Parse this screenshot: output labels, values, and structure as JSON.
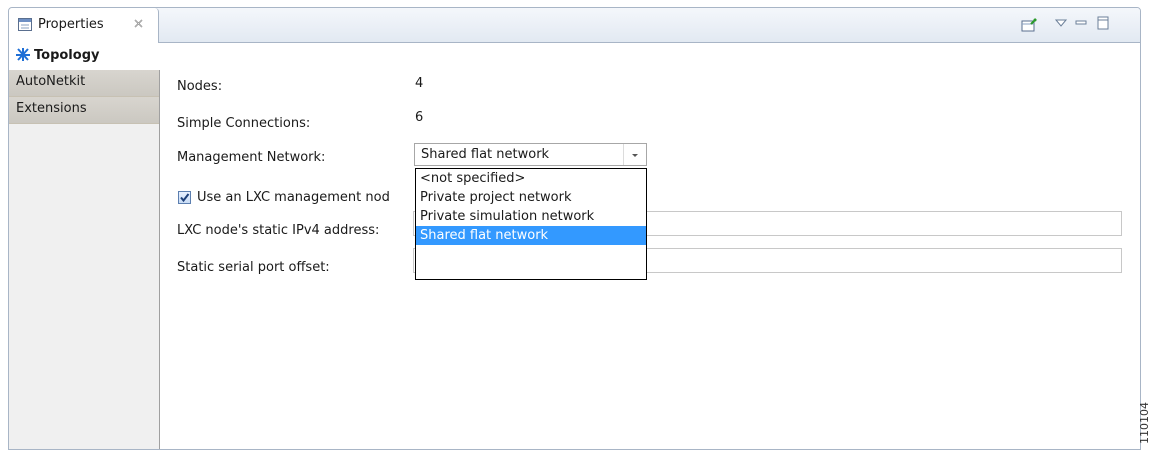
{
  "tab": {
    "title": "Properties"
  },
  "sidebar": {
    "items": [
      {
        "label": "Topology"
      },
      {
        "label": "AutoNetkit"
      },
      {
        "label": "Extensions"
      }
    ]
  },
  "form": {
    "nodes_label": "Nodes:",
    "nodes_value": "4",
    "connections_label": "Simple Connections:",
    "connections_value": "6",
    "mgmt_label": "Management Network:",
    "mgmt_selected": "Shared flat network",
    "lxc_checkbox_label": "Use an LXC management nod",
    "lxc_checkbox_checked": true,
    "lxc_ip_label": "LXC node's static IPv4 address:",
    "lxc_ip_value": "",
    "serial_label": "Static serial port offset:",
    "serial_value": ""
  },
  "dropdown": {
    "options": [
      "<not specified>",
      "Private project network",
      "Private simulation network",
      "Shared flat network"
    ],
    "selected_index": 3
  },
  "side_mark": "110104",
  "colors": {
    "selection": "#3399ff",
    "border": "#a8b5c6",
    "accent_icon": "#1f6fd6"
  }
}
